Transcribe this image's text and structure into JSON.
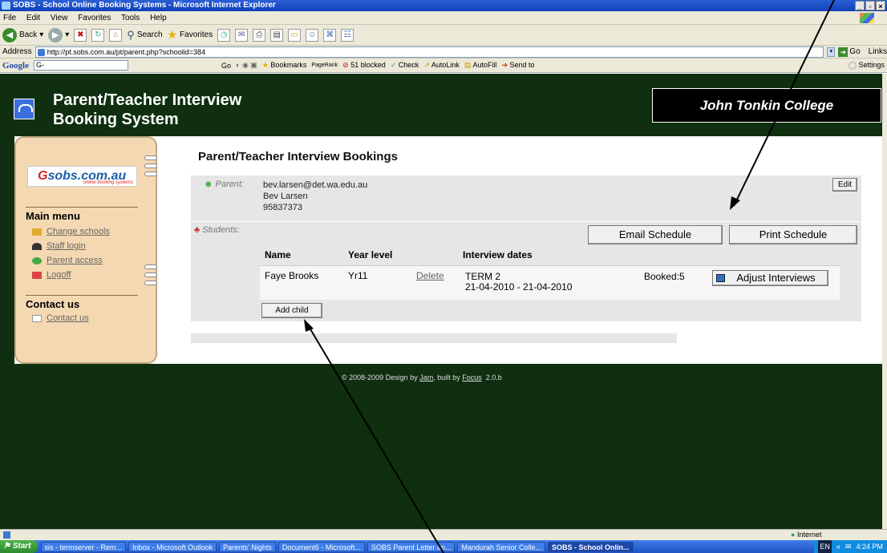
{
  "window": {
    "title": "SOBS - School Online Booking Systems - Microsoft Internet Explorer",
    "controls": [
      "_",
      "▫",
      "×"
    ]
  },
  "menu": [
    "File",
    "Edit",
    "View",
    "Favorites",
    "Tools",
    "Help"
  ],
  "toolbar": {
    "back": "Back",
    "search": "Search",
    "favorites": "Favorites"
  },
  "address": {
    "label": "Address",
    "url": "http://pt.sobs.com.au/pt/parent.php?schoolid=384",
    "go": "Go",
    "links": "Links"
  },
  "googlebar": {
    "brand": "Google",
    "search_placeholder": "G-",
    "go": "Go",
    "bookmarks": "Bookmarks",
    "pagerank": "PageRank",
    "blocked": "51 blocked",
    "check": "Check",
    "autolink": "AutoLink",
    "autofill": "AutoFill",
    "sendto": "Send to",
    "settings": "Settings"
  },
  "site": {
    "title_line1": "Parent/Teacher Interview",
    "title_line2": "Booking System",
    "college": "John Tonkin College"
  },
  "sidebar": {
    "logo_text_g": "G",
    "logo_text": "sobs.com.au",
    "logo_sub": "online booking systems",
    "main_menu": "Main menu",
    "items": [
      {
        "label": "Change schools"
      },
      {
        "label": "Staff login"
      },
      {
        "label": "Parent access"
      },
      {
        "label": "Logoff"
      }
    ],
    "contact_head": "Contact us",
    "contact_link": "Contact us"
  },
  "content": {
    "heading": "Parent/Teacher Interview Bookings",
    "parent_label": "Parent:",
    "parent_email": "bev.larsen@det.wa.edu.au",
    "parent_name": "Bev Larsen",
    "parent_phone": "95837373",
    "edit": "Edit",
    "students_label": "Students:",
    "email_schedule": "Email Schedule",
    "print_schedule": "Print Schedule",
    "columns": [
      "Name",
      "Year level",
      "Interview dates"
    ],
    "student": {
      "name": "Faye Brooks",
      "year": "Yr11",
      "delete": "Delete",
      "term": "TERM 2",
      "dates": "21-04-2010 - 21-04-2010",
      "booked": "Booked:5",
      "adjust": "Adjust Interviews"
    },
    "add_child": "Add child"
  },
  "footer": {
    "prefix": "© 2008-2009 Design by ",
    "jam": "Jam",
    "mid": ", built by ",
    "focus": "Focus",
    "version": "2.0.b"
  },
  "status": {
    "zone": "Internet"
  },
  "taskbar": {
    "start": "Start",
    "tasks": [
      "sis - termserver - Rem...",
      "Inbox - Microsoft Outlook",
      "Parents' Nights",
      "Document6 - Microsoft...",
      "SOBS Parent Letter an...",
      "Mandurah Senior Colle...",
      "SOBS - School Onlin..."
    ],
    "lang": "EN",
    "time": "4:24 PM"
  }
}
